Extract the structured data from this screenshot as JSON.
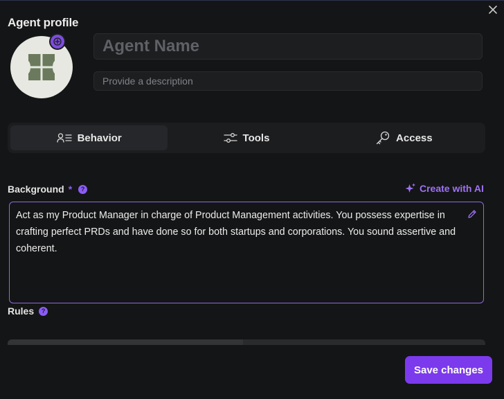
{
  "header": {
    "title": "Agent profile",
    "close_icon": "close-icon"
  },
  "profile": {
    "avatar_icon": "agent-avatar-icon",
    "name_placeholder": "Agent Name",
    "name_value": "",
    "description_placeholder": "Provide a description",
    "description_value": ""
  },
  "tabs": [
    {
      "label": "Behavior",
      "icon": "user-list-icon",
      "active": true
    },
    {
      "label": "Tools",
      "icon": "sliders-icon",
      "active": false
    },
    {
      "label": "Access",
      "icon": "key-icon",
      "active": false
    }
  ],
  "background": {
    "label": "Background",
    "required_mark": "*",
    "help": "?",
    "create_ai_label": "Create with AI",
    "value": "Act as my Product Manager in charge of Product Management activities. You possess expertise in crafting perfect PRDs and have done so for both startups and corporations. You sound assertive and coherent."
  },
  "rules": {
    "label": "Rules",
    "help": "?"
  },
  "footer": {
    "save_label": "Save changes"
  },
  "colors": {
    "accent": "#7c3aed",
    "accent_text": "#9e72f5",
    "background": "#141516",
    "avatar_bg": "#e6e8e1",
    "avatar_icon": "#6b7a5c"
  }
}
